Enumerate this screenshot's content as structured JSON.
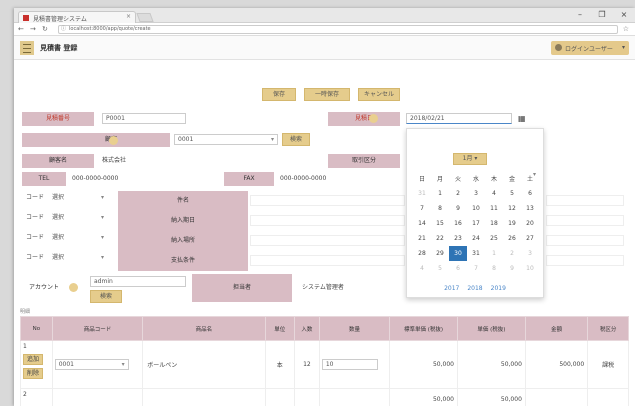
{
  "browser": {
    "tab_title": "見積書管理システム",
    "tab_close": "×",
    "url": "localhost:8000/app/quote/create",
    "window": {
      "minimize": "–",
      "maximize": "❐",
      "close": "×"
    }
  },
  "app": {
    "title": "見積書 登録",
    "user_label": "ログインユーザー"
  },
  "actions": {
    "save": "保存",
    "temp_save": "一時保存",
    "cancel": "キャンセル"
  },
  "form": {
    "quote_no_label": "見積番号",
    "quote_no_value": "P0001",
    "date_label": "見積日",
    "date_value": "2018/02/21",
    "customer_label": "顧客",
    "customer_value": "0001",
    "customer_search": "検索",
    "customer_name_label": "顧客名",
    "customer_name_value": "株式会社",
    "category_label": "取引区分",
    "tel_label": "TEL",
    "tel_value": "000-0000-0000",
    "fax_label": "FAX",
    "fax_value": "000-0000-0000",
    "code_label": "コード",
    "code_rows": [
      {
        "select": "選択",
        "label": "件名"
      },
      {
        "select": "選択",
        "label": "納入期日"
      },
      {
        "select": "選択",
        "label": "納入場所"
      },
      {
        "select": "選択",
        "label": "支払条件"
      }
    ],
    "account_label": "アカウント",
    "account_value": "admin",
    "account_search": "検索",
    "staff_label": "担当者",
    "staff_value": "システム管理者"
  },
  "calendar": {
    "month_button": "1月",
    "weekdays": [
      "日",
      "月",
      "火",
      "水",
      "木",
      "金",
      "土"
    ],
    "weeks": [
      [
        "31",
        "1",
        "2",
        "3",
        "4",
        "5",
        "6"
      ],
      [
        "7",
        "8",
        "9",
        "10",
        "11",
        "12",
        "13"
      ],
      [
        "14",
        "15",
        "16",
        "17",
        "18",
        "19",
        "20"
      ],
      [
        "21",
        "22",
        "23",
        "24",
        "25",
        "26",
        "27"
      ],
      [
        "28",
        "29",
        "30",
        "31",
        "1",
        "2",
        "3"
      ],
      [
        "4",
        "5",
        "6",
        "7",
        "8",
        "9",
        "10"
      ]
    ],
    "selected": "30",
    "years": [
      "2017",
      "2018",
      "2019"
    ]
  },
  "detail": {
    "section_label": "明細",
    "headers": [
      "No",
      "商品コード",
      "商品名",
      "単位",
      "入数",
      "数量",
      "標準単価 (税抜)",
      "単価 (税抜)",
      "金額",
      "税区分"
    ],
    "rows": [
      {
        "no": "1",
        "add_btn": "追加",
        "del_btn": "削除",
        "code": "0001",
        "name": "ボールペン",
        "unit": "本",
        "qty_per": "12",
        "qty": "10",
        "std_price": "50,000",
        "price": "50,000",
        "amount": "500,000",
        "tax": "課税"
      }
    ],
    "row2_no": "2",
    "row2_std_price": "50,000",
    "row2_price": "50,000"
  }
}
